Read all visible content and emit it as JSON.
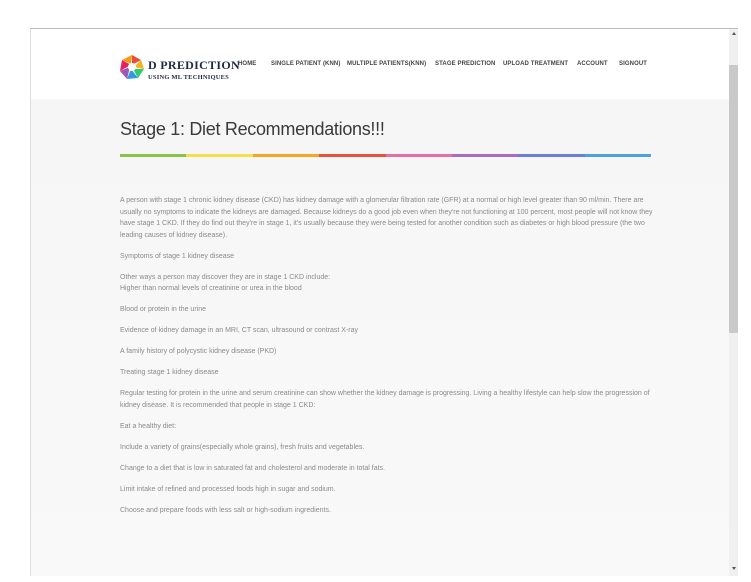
{
  "brand": {
    "title": "D PREDICTION",
    "subtitle": "USING ML TECHNIQUES",
    "colors": [
      "#e84c3d",
      "#f5b11e",
      "#2ecc71",
      "#3498db",
      "#9b59b6",
      "#e91e63"
    ]
  },
  "nav": {
    "items": [
      {
        "label": "HOME"
      },
      {
        "label": "SINGLE PATIENT (KNN)"
      },
      {
        "label": "MULTIPLE PATIENTS(KNN)"
      },
      {
        "label": "STAGE PREDICTION"
      },
      {
        "label": "UPLOAD TREATMENT"
      },
      {
        "label": "ACCOUNT"
      },
      {
        "label": "SIGNOUT"
      }
    ]
  },
  "page": {
    "title": "Stage 1: Diet Recommendations!!!",
    "divider_colors": [
      "#8bc34a",
      "#f4e04d",
      "#f5a623",
      "#e8513d",
      "#e66fa4",
      "#a86cc1",
      "#6c7fd8",
      "#4aa3df"
    ]
  },
  "content": {
    "intro": "A person with stage 1 chronic kidney disease (CKD) has kidney damage with a glomerular filtration rate (GFR) at a normal or high level greater than 90 ml/min. There are usually no symptoms to indicate the kidneys are damaged. Because kidneys do a good job even when they're not functioning at 100 percent, most people will not know they have stage 1 CKD. If they do find out they're in stage 1, it's usually because they were being tested for another condition such as diabetes or high blood pressure (the two leading causes of kidney disease).",
    "symptoms_heading": "Symptoms of stage 1 kidney disease",
    "discover_heading": "Other ways a person may discover they are in stage 1 CKD include:",
    "item_creatinine": "Higher than normal levels of creatinine or urea in the blood",
    "item_blood": "Blood or protein in the urine",
    "item_evidence": "Evidence of kidney damage in an MRI, CT scan, ultrasound or contrast X-ray",
    "item_family": "A family history of polycystic kidney disease (PKD)",
    "treating_heading": "Treating stage 1 kidney disease",
    "regular_testing": "Regular testing for protein in the urine and serum creatinine can show whether the kidney damage is progressing. Living a healthy lifestyle can help slow the progression of kidney disease. It is recommended that people in stage 1 CKD:",
    "eat_healthy": "Eat a healthy diet:",
    "diet_grains": "Include a variety of grains(especially whole grains), fresh fruits and vegetables.",
    "diet_fat": "Change to a diet that is low in saturated fat and cholesterol and moderate in total fats.",
    "diet_sugar": "Limit intake of refined and processed foods high in sugar and sodium.",
    "diet_salt": "Choose and prepare foods with less salt or high-sodium ingredients."
  }
}
